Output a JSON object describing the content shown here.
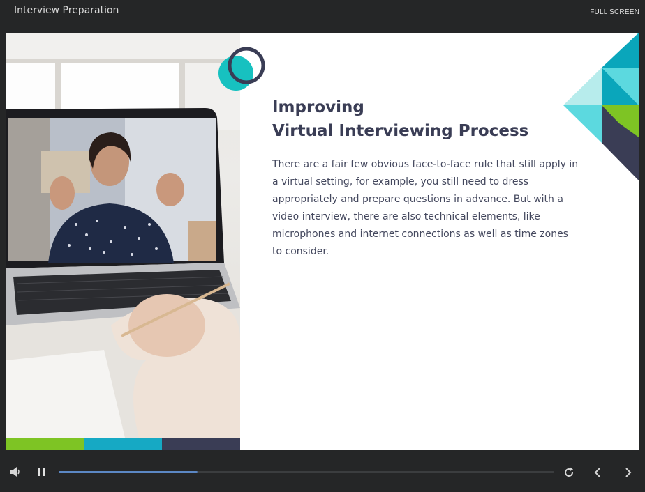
{
  "header": {
    "course_title": "Interview Preparation",
    "fullscreen_label": "FULL SCREEN"
  },
  "slide": {
    "heading_line1": "Improving",
    "heading_line2": "Virtual Interviewing Process",
    "body": "There are a fair few obvious face-to-face rule that still apply in a virtual setting, for example, you still need to dress appropriately and prepare questions in advance. But with a video interview, there are also technical elements, like microphones and internet connections as well as time zones to consider.",
    "photo_description_icon": "woman-video-call-photo",
    "stripe_colors": [
      "#7ec424",
      "#16a9c4",
      "#3a3d55"
    ]
  },
  "colors": {
    "heading": "#3a3d55",
    "teal": "#17c1c0",
    "teal_dark": "#0aa6bb",
    "teal_light": "#5cd9df",
    "teal_pale": "#b7ecec",
    "green": "#7ec424",
    "navy": "#3a3d55",
    "progress": "#5b87c4"
  },
  "player": {
    "volume_icon": "volume-icon",
    "pause_icon": "pause-icon",
    "replay_icon": "replay-icon",
    "prev_icon": "chevron-left-icon",
    "next_icon": "chevron-right-icon",
    "progress": 0.28
  }
}
